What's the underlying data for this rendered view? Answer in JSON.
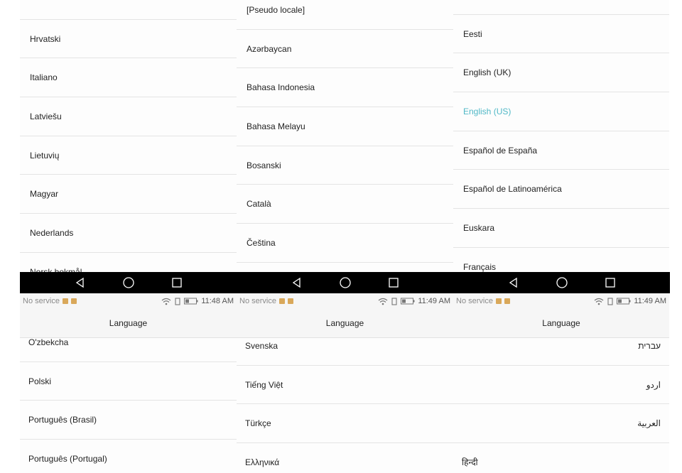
{
  "top_panels": [
    {
      "items": [
        "Hrvatski",
        "Italiano",
        "Latviešu",
        "Lietuvių",
        "Magyar",
        "Nederlands",
        "Norsk bokmål"
      ],
      "selected": null
    },
    {
      "items": [
        "[Pseudo locale]",
        "Azərbaycan",
        "Bahasa Indonesia",
        "Bahasa Melayu",
        "Bosanski",
        "Català",
        "Čeština"
      ],
      "selected": null
    },
    {
      "items": [
        "Eesti",
        "English (UK)",
        "English (US)",
        "Español de España",
        "Español de Latinoamérica",
        "Euskara",
        "Français"
      ],
      "selected": 2
    }
  ],
  "bottom_panels": [
    {
      "carrier": "No service",
      "time": "11:48 AM",
      "title": "Language",
      "items": [
        "O'zbekcha",
        "Polski",
        "Português (Brasil)",
        "Português (Portugal)"
      ]
    },
    {
      "carrier": "No service",
      "time": "11:49 AM",
      "title": "Language",
      "items": [
        "Svenska",
        "Tiếng Việt",
        "Türkçe",
        "Ελληνικά"
      ]
    },
    {
      "carrier": "No service",
      "time": "11:49 AM",
      "title": "Language",
      "items": [
        "עברית",
        "اردو",
        "العربية",
        "हिन्दी"
      ]
    }
  ],
  "nav_icons": [
    "back-icon",
    "home-icon",
    "recents-icon"
  ],
  "colors": {
    "selected": "#4fb8c6",
    "navbar": "#000000"
  }
}
